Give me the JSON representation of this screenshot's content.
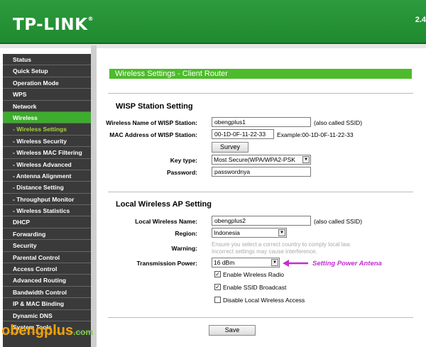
{
  "header": {
    "logo": "TP-LINK",
    "logo_reg": "®",
    "version": "2.4"
  },
  "sidebar": {
    "items": [
      {
        "label": "Status",
        "type": "main"
      },
      {
        "label": "Quick Setup",
        "type": "main"
      },
      {
        "label": "Operation Mode",
        "type": "main"
      },
      {
        "label": "WPS",
        "type": "main"
      },
      {
        "label": "Network",
        "type": "main"
      },
      {
        "label": "Wireless",
        "type": "active"
      },
      {
        "label": "- Wireless Settings",
        "type": "sub-active"
      },
      {
        "label": "- Wireless Security",
        "type": "sub"
      },
      {
        "label": "- Wireless MAC Filtering",
        "type": "sub"
      },
      {
        "label": "- Wireless Advanced",
        "type": "sub"
      },
      {
        "label": "- Antenna Alignment",
        "type": "sub"
      },
      {
        "label": "- Distance Setting",
        "type": "sub"
      },
      {
        "label": "- Throughput Monitor",
        "type": "sub"
      },
      {
        "label": "- Wireless Statistics",
        "type": "sub"
      },
      {
        "label": "DHCP",
        "type": "main"
      },
      {
        "label": "Forwarding",
        "type": "main"
      },
      {
        "label": "Security",
        "type": "main"
      },
      {
        "label": "Parental Control",
        "type": "main"
      },
      {
        "label": "Access Control",
        "type": "main"
      },
      {
        "label": "Advanced Routing",
        "type": "main"
      },
      {
        "label": "Bandwidth Control",
        "type": "main"
      },
      {
        "label": "IP & MAC Binding",
        "type": "main"
      },
      {
        "label": "Dynamic DNS",
        "type": "main"
      },
      {
        "label": "System Tools",
        "type": "main"
      }
    ]
  },
  "page": {
    "title": "Wireless Settings - Client Router"
  },
  "wisp": {
    "heading": "WISP Station Setting",
    "name_label": "Wireless Name of WISP Station:",
    "name_value": "obengplus1",
    "name_note": "(also called SSID)",
    "mac_label": "MAC Address of WISP Station:",
    "mac_value": "00-1D-0F-11-22-33",
    "mac_note": "Example:00-1D-0F-11-22-33",
    "survey_label": "Survey",
    "keytype_label": "Key type:",
    "keytype_value": "Most Secure(WPA/WPA2-PSK",
    "password_label": "Password:",
    "password_value": "passwordnya"
  },
  "ap": {
    "heading": "Local Wireless AP Setting",
    "name_label": "Local Wireless Name:",
    "name_value": "obengplus2",
    "name_note": "(also called SSID)",
    "region_label": "Region:",
    "region_value": "Indonesia",
    "warning_label": "Warning:",
    "warning_line1": "Ensure you select a correct country to comply local law.",
    "warning_line2": "Incorrect settings may cause interference.",
    "power_label": "Transmission Power:",
    "power_value": "16 dBm",
    "enable_radio_label": "Enable Wireless Radio",
    "enable_radio_checked": true,
    "enable_ssid_label": "Enable SSID Broadcast",
    "enable_ssid_checked": true,
    "disable_local_label": "Disable Local Wireless Access",
    "disable_local_checked": false
  },
  "save_label": "Save",
  "annotation": {
    "text": "Setting Power Antena",
    "color": "#c32fd1"
  },
  "watermark": {
    "text": "obengplus",
    "domain": ".com"
  },
  "colors": {
    "brand_green": "#2e9b3e",
    "active_green": "#3cad2c",
    "sidebar_bg": "#3a3a3a"
  }
}
